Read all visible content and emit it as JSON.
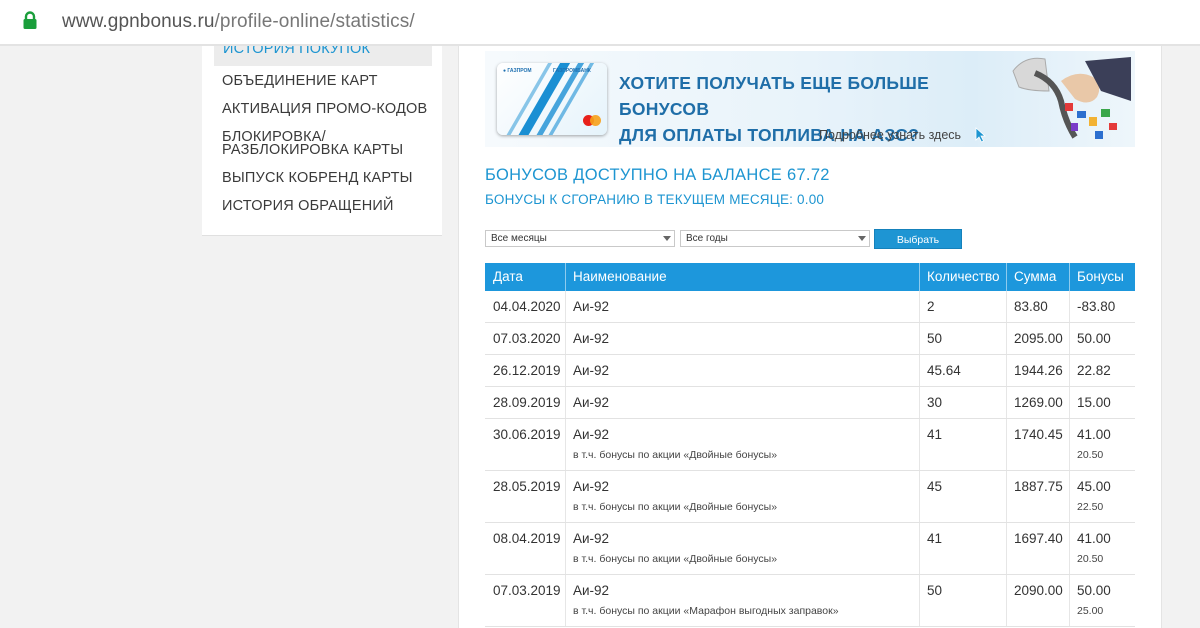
{
  "browser": {
    "url_host": "www.gpnbonus.ru",
    "url_path": "/profile-online/statistics/"
  },
  "sidebar": {
    "active_item": "История покупок",
    "items": [
      "Объединение карт",
      "Активация промо-кодов",
      "Блокировка/",
      "разблокировка карты",
      "Выпуск кобренд карты",
      "История обращений"
    ]
  },
  "banner": {
    "title_line1": "Хотите получать еще больше бонусов",
    "title_line2": "для оплаты топлива на АЗС?",
    "more_link": "Подробнее узнать здесь"
  },
  "summary": {
    "balance": "Бонусов доступно на балансе 67.72",
    "expiring": "Бонусы к сгоранию в текущем месяце: 0.00"
  },
  "filters": {
    "month_value": "Все месяцы",
    "year_value": "Все годы",
    "submit_label": "Выбрать"
  },
  "table": {
    "columns": [
      "Дата",
      "Наименование",
      "Количество",
      "Сумма",
      "Бонусы"
    ],
    "rows": [
      {
        "date": "04.04.2020",
        "name": "Аи-92",
        "qty": "2",
        "sum": "83.80",
        "bonus": "-83.80"
      },
      {
        "date": "07.03.2020",
        "name": "Аи-92",
        "qty": "50",
        "sum": "2095.00",
        "bonus": "50.00"
      },
      {
        "date": "26.12.2019",
        "name": "Аи-92",
        "qty": "45.64",
        "sum": "1944.26",
        "bonus": "22.82"
      },
      {
        "date": "28.09.2019",
        "name": "Аи-92",
        "qty": "30",
        "sum": "1269.00",
        "bonus": "15.00"
      },
      {
        "date": "30.06.2019",
        "name": "Аи-92",
        "qty": "41",
        "sum": "1740.45",
        "bonus": "41.00",
        "note": "в т.ч. бонусы по акции «Двойные бонусы»",
        "note_bonus": "20.50"
      },
      {
        "date": "28.05.2019",
        "name": "Аи-92",
        "qty": "45",
        "sum": "1887.75",
        "bonus": "45.00",
        "note": "в т.ч. бонусы по акции «Двойные бонусы»",
        "note_bonus": "22.50"
      },
      {
        "date": "08.04.2019",
        "name": "Аи-92",
        "qty": "41",
        "sum": "1697.40",
        "bonus": "41.00",
        "note": "в т.ч. бонусы по акции «Двойные бонусы»",
        "note_bonus": "20.50"
      },
      {
        "date": "07.03.2019",
        "name": "Аи-92",
        "qty": "50",
        "sum": "2090.00",
        "bonus": "50.00",
        "note": "в т.ч. бонусы по акции «Марафон выгодных заправок»",
        "note_bonus": "25.00"
      }
    ]
  },
  "colors": {
    "accent": "#1d95d1",
    "header_bg": "#1d97dc",
    "lock_green": "#1a9e3b"
  }
}
